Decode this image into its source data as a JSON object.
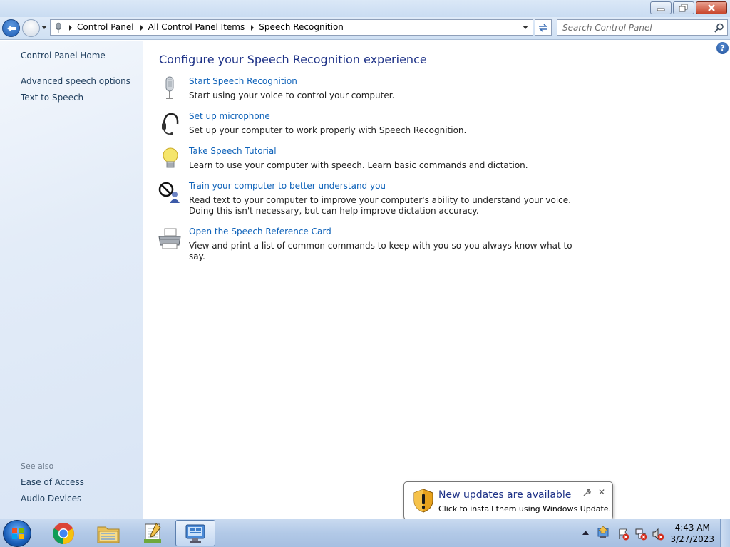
{
  "address": {
    "breadcrumbs": [
      "Control Panel",
      "All Control Panel Items",
      "Speech Recognition"
    ]
  },
  "search": {
    "placeholder": "Search Control Panel"
  },
  "sidebar": {
    "links": [
      "Control Panel Home",
      "Advanced speech options",
      "Text to Speech"
    ],
    "see_also_heading": "See also",
    "see_also": [
      "Ease of Access",
      "Audio Devices"
    ]
  },
  "main": {
    "title": "Configure your Speech Recognition experience",
    "tasks": [
      {
        "icon": "microphone-icon",
        "title": "Start Speech Recognition",
        "description": "Start using your voice to control your computer."
      },
      {
        "icon": "headset-icon",
        "title": "Set up microphone",
        "description": "Set up your computer to work properly with Speech Recognition."
      },
      {
        "icon": "lightbulb-icon",
        "title": "Take Speech Tutorial",
        "description": "Learn to use your computer with speech.  Learn basic commands and dictation."
      },
      {
        "icon": "training-icon",
        "title": "Train your computer to better understand you",
        "description": "Read text to your computer to improve your computer's ability to understand your voice.  Doing this isn't necessary, but can help improve dictation accuracy."
      },
      {
        "icon": "printer-icon",
        "title": "Open the Speech Reference Card",
        "description": "View and print a list of common commands to keep with you so you always know what to say."
      }
    ]
  },
  "notification": {
    "title": "New updates are available",
    "text": "Click to install them using Windows Update."
  },
  "taskbar": {
    "apps": [
      "chrome-icon",
      "explorer-icon",
      "notepad-icon",
      "control-panel-icon"
    ],
    "time": "4:43 AM",
    "date": "3/27/2023"
  },
  "colors": {
    "link": "#0e62b9",
    "title": "#1e3287",
    "sidebar_link": "#1e3d5c"
  }
}
